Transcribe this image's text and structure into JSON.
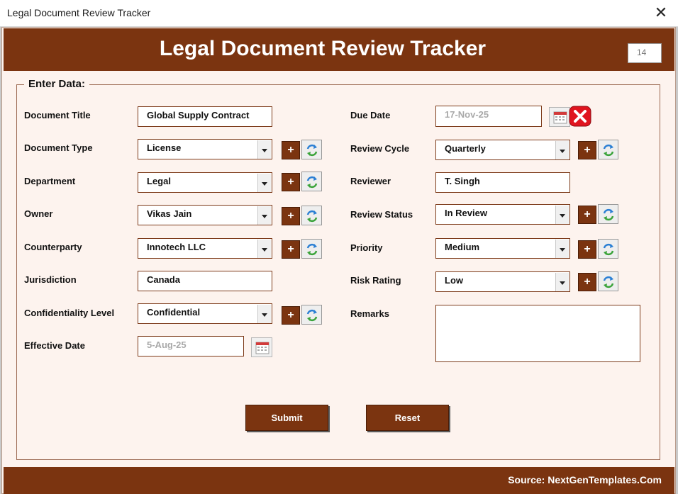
{
  "window": {
    "title": "Legal Document Review Tracker",
    "close_glyph": "✕"
  },
  "header": {
    "title": "Legal Document Review Tracker",
    "counter": "14"
  },
  "section": {
    "legend": "Enter Data:"
  },
  "left": {
    "document_title": {
      "label": "Document Title",
      "value": "Global Supply Contract"
    },
    "document_type": {
      "label": "Document Type",
      "value": "License"
    },
    "department": {
      "label": "Department",
      "value": "Legal"
    },
    "owner": {
      "label": "Owner",
      "value": "Vikas Jain"
    },
    "counterparty": {
      "label": "Counterparty",
      "value": "Innotech LLC"
    },
    "jurisdiction": {
      "label": "Jurisdiction",
      "value": "Canada"
    },
    "confidentiality": {
      "label": "Confidentiality Level",
      "value": "Confidential"
    },
    "effective_date": {
      "label": "Effective Date",
      "value": "5-Aug-25"
    }
  },
  "right": {
    "due_date": {
      "label": "Due Date",
      "value": "17-Nov-25"
    },
    "review_cycle": {
      "label": "Review Cycle",
      "value": "Quarterly"
    },
    "reviewer": {
      "label": "Reviewer",
      "value": "T. Singh"
    },
    "review_status": {
      "label": "Review Status",
      "value": "In Review"
    },
    "priority": {
      "label": "Priority",
      "value": "Medium"
    },
    "risk_rating": {
      "label": "Risk Rating",
      "value": "Low"
    },
    "remarks": {
      "label": "Remarks",
      "value": ""
    }
  },
  "buttons": {
    "plus": "+",
    "submit": "Submit",
    "reset": "Reset"
  },
  "footer": {
    "source": "Source: NextGenTemplates.Com"
  },
  "icons": {
    "add": "plus-icon",
    "refresh": "refresh-icon",
    "calendar": "calendar-icon",
    "clear": "clear-x-icon",
    "dropdown": "chevron-down-icon"
  },
  "colors": {
    "brand": "#7b3410",
    "background": "#fdf3ee",
    "field_border": "#7d3b1a"
  }
}
